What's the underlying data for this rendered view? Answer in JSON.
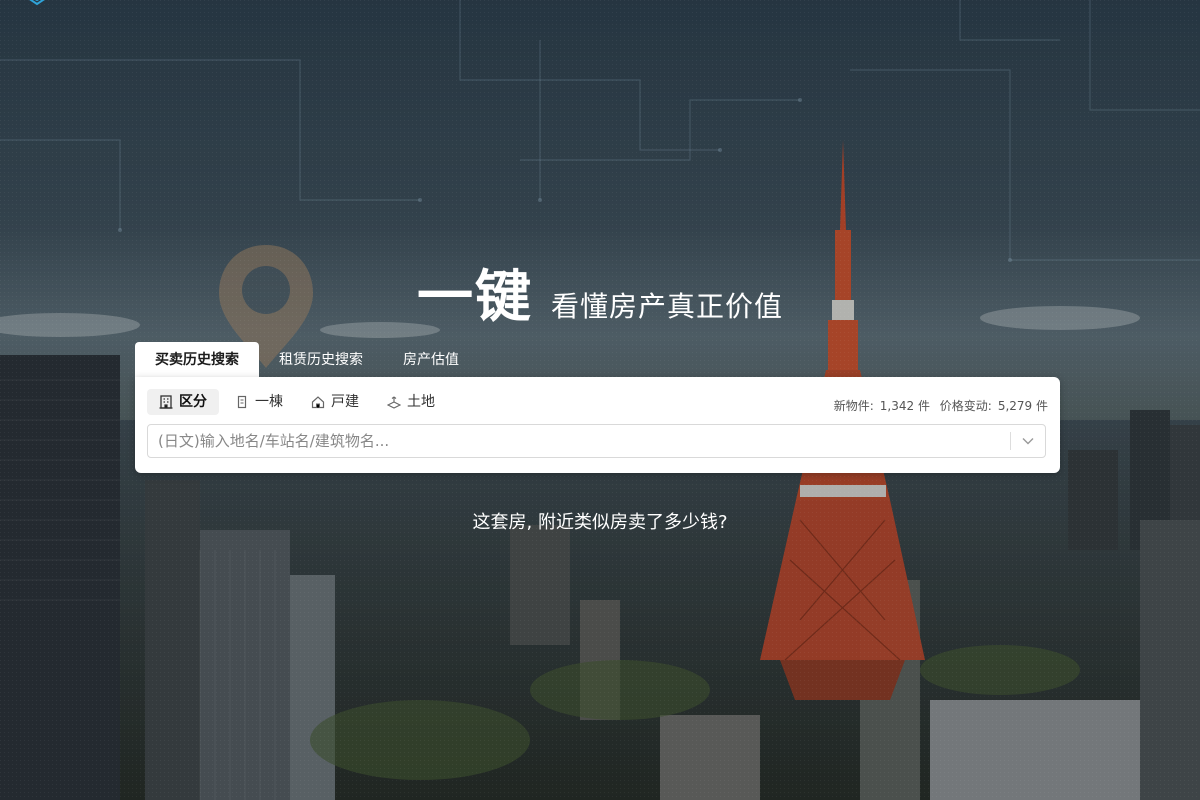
{
  "hero": {
    "title_main": "一键",
    "title_sub": "看懂房产真正价值",
    "question": "这套房, 附近类似房卖了多少钱?"
  },
  "tabs": [
    {
      "label": "买卖历史搜索",
      "active": true
    },
    {
      "label": "租赁历史搜索",
      "active": false
    },
    {
      "label": "房产估值",
      "active": false
    }
  ],
  "property_types": [
    {
      "label": "区分",
      "icon": "building-icon",
      "active": true
    },
    {
      "label": "一棟",
      "icon": "building-small-icon",
      "active": false
    },
    {
      "label": "戸建",
      "icon": "house-icon",
      "active": false
    },
    {
      "label": "土地",
      "icon": "land-icon",
      "active": false
    }
  ],
  "stats": {
    "new_label": "新物件:",
    "new_value": "1,342 件",
    "change_label": "价格变动:",
    "change_value": "5,279 件"
  },
  "search": {
    "placeholder": "(日文)输入地名/车站名/建筑物名..."
  },
  "colors": {
    "accent": "#2fa3d8",
    "tab_active_bg": "#ffffff"
  }
}
